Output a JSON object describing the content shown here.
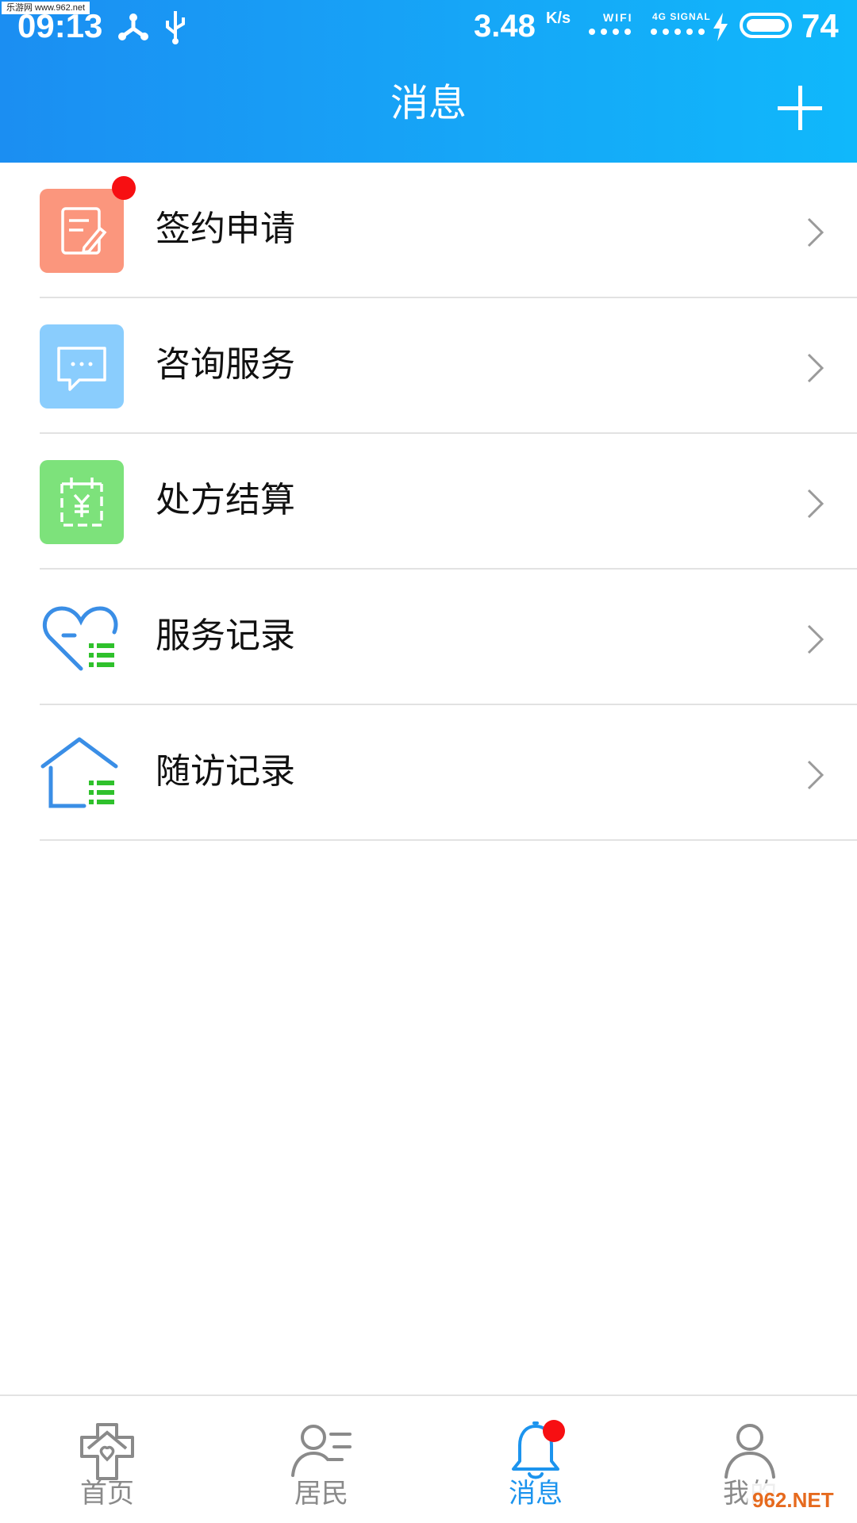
{
  "status_bar": {
    "watermark": "乐游网 www.962.net",
    "time": "09:13",
    "net_speed": "3.48",
    "net_speed_unit": "K/s",
    "wifi_label": "WIFI",
    "signal_label": "4G SIGNAL",
    "battery": "74",
    "icons": [
      "nfc-icon",
      "usb-icon",
      "charging-icon",
      "battery-icon"
    ]
  },
  "header": {
    "title": "消息",
    "add_icon": "plus-icon"
  },
  "menu": {
    "items": [
      {
        "label": "签约申请",
        "icon": "contract-edit-icon",
        "tile_color": "#fb967d",
        "has_badge": true
      },
      {
        "label": "咨询服务",
        "icon": "chat-bubble-icon",
        "tile_color": "#8acdfd",
        "has_badge": false
      },
      {
        "label": "处方结算",
        "icon": "yuan-receipt-icon",
        "tile_color": "#7de27b",
        "has_badge": false
      },
      {
        "label": "服务记录",
        "icon": "heart-list-icon",
        "tile_color": "",
        "has_badge": false
      },
      {
        "label": "随访记录",
        "icon": "house-list-icon",
        "tile_color": "",
        "has_badge": false
      }
    ],
    "chevron_icon": "chevron-right-icon"
  },
  "tabbar": {
    "tabs": [
      {
        "label": "首页",
        "icon": "home-cross-icon",
        "active": false
      },
      {
        "label": "居民",
        "icon": "resident-list-icon",
        "active": false
      },
      {
        "label": "消息",
        "icon": "bell-icon",
        "active": true,
        "has_badge": true
      },
      {
        "label": "我的",
        "icon": "person-icon",
        "active": false
      }
    ]
  },
  "watermark_corner": "962.NET",
  "colors": {
    "header_blue": "#1b9cf5",
    "active_tab": "#1c94ee",
    "badge_red": "#f70f12",
    "list_green": "#2fc12c"
  }
}
